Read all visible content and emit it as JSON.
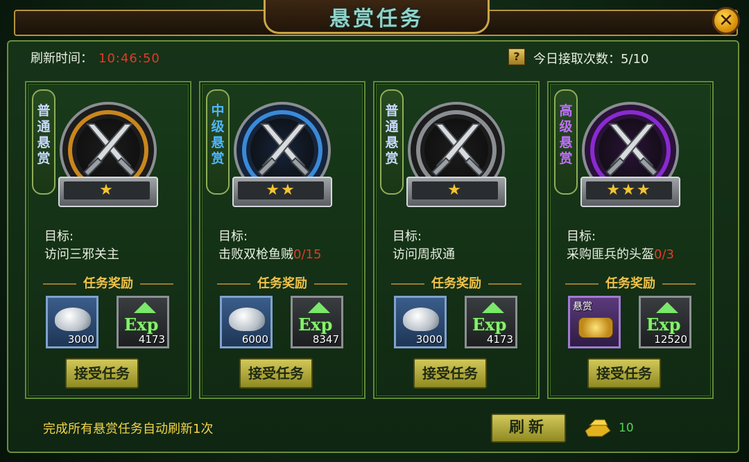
{
  "header": {
    "title": "悬赏任务"
  },
  "close": {
    "icon": "close-icon",
    "glyph": "✕"
  },
  "info": {
    "refresh_label": "刷新时间：",
    "refresh_value": "10:46:50",
    "help_glyph": "?",
    "daily_count": "今日接取次数：5/10"
  },
  "cards": [
    {
      "tier": [
        "普",
        "通",
        "悬",
        "赏"
      ],
      "tier_color": "#c8d8ff",
      "ring_color": "#c9861e",
      "core_color": "#1c1c1c",
      "stars": "★",
      "goal_label": "目标:",
      "goal": "访问三邪关主",
      "progress": "",
      "reward_title": "任务奖励",
      "reward1_type": "silver",
      "reward1_qty": "3000",
      "reward1_label": "",
      "reward2_qty": "4173",
      "exp_label": "Exp",
      "accept": "接受任务"
    },
    {
      "tier": [
        "中",
        "级",
        "悬",
        "赏"
      ],
      "tier_color": "#4fb6ff",
      "ring_color": "#3a8ad8",
      "core_color": "#16243a",
      "stars": "★★",
      "goal_label": "目标:",
      "goal": "击败双枪鱼贼",
      "progress": "0/15",
      "reward_title": "任务奖励",
      "reward1_type": "silver",
      "reward1_qty": "6000",
      "reward1_label": "",
      "reward2_qty": "8347",
      "exp_label": "Exp",
      "accept": "接受任务"
    },
    {
      "tier": [
        "普",
        "通",
        "悬",
        "赏"
      ],
      "tier_color": "#c8d8ff",
      "ring_color": "#8a8e92",
      "core_color": "#1c1c1c",
      "stars": "★",
      "goal_label": "目标:",
      "goal": "访问周叔通",
      "progress": "",
      "reward_title": "任务奖励",
      "reward1_type": "silver",
      "reward1_qty": "3000",
      "reward1_label": "",
      "reward2_qty": "4173",
      "exp_label": "Exp",
      "accept": "接受任务"
    },
    {
      "tier": [
        "高",
        "级",
        "悬",
        "赏"
      ],
      "tier_color": "#c070ff",
      "ring_color": "#8a2ad0",
      "core_color": "#2a1238",
      "stars": "★★★",
      "goal_label": "目标:",
      "goal": "采购匪兵的头盔",
      "progress": "0/3",
      "reward_title": "任务奖励",
      "reward1_type": "token",
      "reward1_qty": "",
      "reward1_label": "悬赏",
      "reward2_qty": "12520",
      "exp_label": "Exp",
      "accept": "接受任务"
    }
  ],
  "footer": {
    "note": "完成所有悬赏任务自动刷新1次",
    "refresh_button": "刷新",
    "gold_icon": "gold-ingot-icon",
    "cost": "10"
  }
}
